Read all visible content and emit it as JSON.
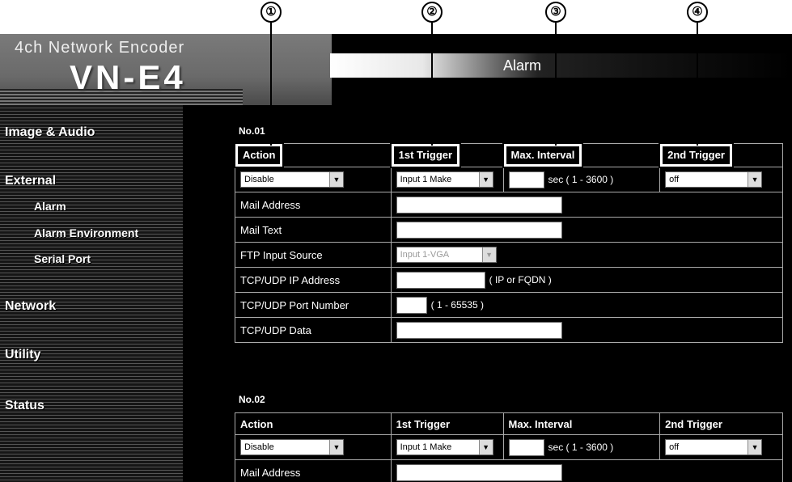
{
  "callouts": [
    "①",
    "②",
    "③",
    "④"
  ],
  "header": {
    "subtitle": "4ch Network Encoder",
    "model": "VN-E4",
    "page_title": "Alarm"
  },
  "nav": {
    "image_audio": "Image & Audio",
    "external": "External",
    "alarm": "Alarm",
    "alarm_environment": "Alarm Environment",
    "serial_port": "Serial Port",
    "network": "Network",
    "utility": "Utility",
    "status": "Status"
  },
  "columns": {
    "action": "Action",
    "first_trigger": "1st Trigger",
    "max_interval": "Max. Interval",
    "second_trigger": "2nd Trigger"
  },
  "sections": [
    {
      "label": "No.01",
      "action_value": "Disable",
      "first_trigger_value": "Input 1 Make",
      "interval_unit": "sec ( 1 - 3600 )",
      "second_trigger_value": "off",
      "mail_address_label": "Mail Address",
      "mail_text_label": "Mail Text",
      "ftp_label": "FTP Input Source",
      "ftp_value": "Input 1-VGA",
      "ip_label": "TCP/UDP IP Address",
      "ip_hint": "( IP or FQDN )",
      "port_label": "TCP/UDP Port Number",
      "port_hint": "( 1 - 65535 )",
      "data_label": "TCP/UDP Data"
    },
    {
      "label": "No.02",
      "action_value": "Disable",
      "first_trigger_value": "Input 1 Make",
      "interval_unit": "sec ( 1 - 3600 )",
      "second_trigger_value": "off",
      "mail_address_label": "Mail Address"
    }
  ]
}
